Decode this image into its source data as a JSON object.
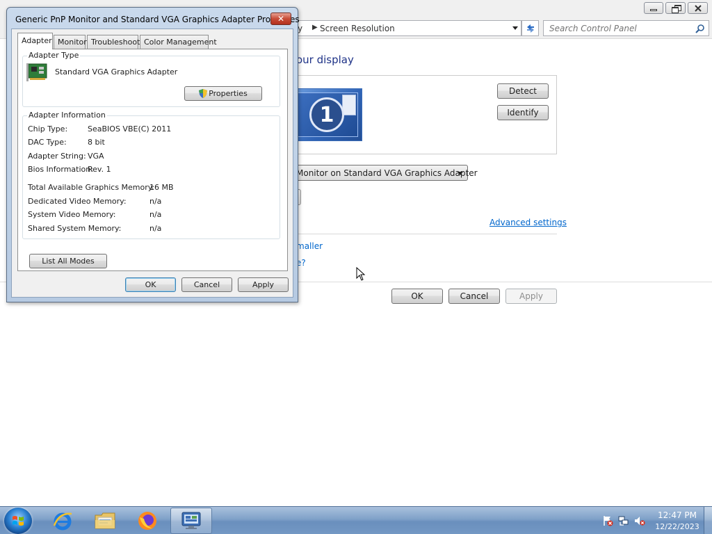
{
  "control_panel": {
    "breadcrumb_prev": "y",
    "breadcrumb_current": "Screen Resolution",
    "search_placeholder": "Search Control Panel",
    "heading": "our display",
    "monitor_number": "1",
    "detect_label": "Detect",
    "identify_label": "Identify",
    "display_select": "Monitor on Standard VGA Graphics Adapter",
    "advanced_settings_link": "Advanced settings",
    "link_smaller": "maller",
    "link_settings": "e?",
    "ok_label": "OK",
    "cancel_label": "Cancel",
    "apply_label": "Apply"
  },
  "dialog": {
    "title": "Generic PnP Monitor and Standard VGA Graphics Adapter Properties",
    "close_glyph": "✕",
    "tabs": [
      {
        "label": "Adapter",
        "active": true
      },
      {
        "label": "Monitor",
        "active": false
      },
      {
        "label": "Troubleshoot",
        "active": false
      },
      {
        "label": "Color Management",
        "active": false
      }
    ],
    "adapter_type_group": "Adapter Type",
    "adapter_name": "Standard VGA Graphics Adapter",
    "properties_label": "Properties",
    "adapter_info_group": "Adapter Information",
    "info": [
      {
        "label": "Chip Type:",
        "value": "SeaBIOS VBE(C) 2011"
      },
      {
        "label": "DAC Type:",
        "value": "8 bit"
      },
      {
        "label": "Adapter String:",
        "value": "VGA"
      },
      {
        "label": "Bios Information:",
        "value": "Rev. 1"
      }
    ],
    "memory": [
      {
        "label": "Total Available Graphics Memory:",
        "value": "16 MB"
      },
      {
        "label": "Dedicated Video Memory:",
        "value": "n/a"
      },
      {
        "label": "System Video Memory:",
        "value": "n/a"
      },
      {
        "label": "Shared System Memory:",
        "value": "n/a"
      }
    ],
    "list_all_modes_label": "List All Modes",
    "ok_label": "OK",
    "cancel_label": "Cancel",
    "apply_label": "Apply"
  },
  "taskbar": {
    "pinned": [
      "internet-explorer",
      "windows-explorer",
      "firefox",
      "control-panel"
    ],
    "clock_time": "12:47 PM",
    "clock_date": "12/22/2023"
  },
  "colors": {
    "link": "#0066cc",
    "heading": "#1e3287",
    "close_button": "#c74b37",
    "taskbar": "#7fa1c8"
  }
}
